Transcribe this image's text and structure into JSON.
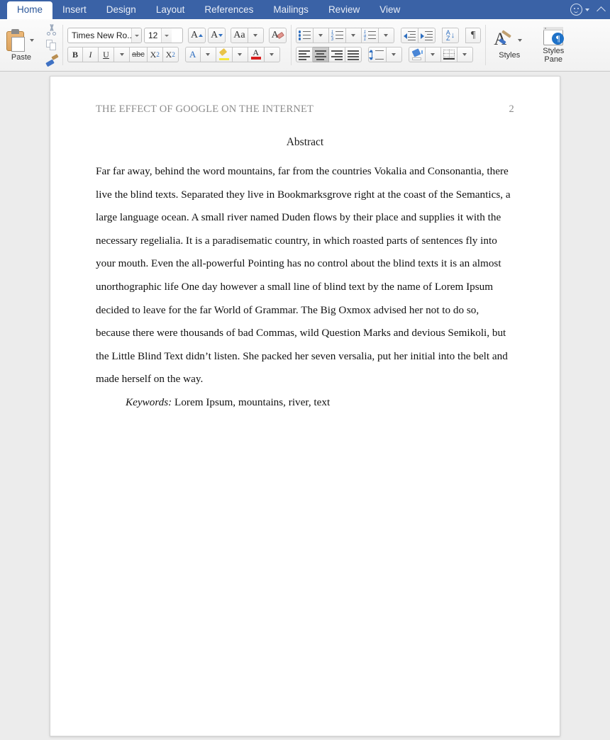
{
  "ribbon": {
    "tabs": [
      {
        "label": "Home",
        "active": true
      },
      {
        "label": "Insert",
        "active": false
      },
      {
        "label": "Design",
        "active": false
      },
      {
        "label": "Layout",
        "active": false
      },
      {
        "label": "References",
        "active": false
      },
      {
        "label": "Mailings",
        "active": false
      },
      {
        "label": "Review",
        "active": false
      },
      {
        "label": "View",
        "active": false
      }
    ],
    "right_controls": {
      "smiley_icon": "smiley-face-icon",
      "smiley_dropdown": "chevron-down-icon",
      "collapse_ribbon": "chevron-up-icon"
    },
    "clipboard": {
      "paste_label": "Paste",
      "paste_icon": "clipboard-paste-icon",
      "paste_dropdown": "chevron-down-icon",
      "cut_icon": "scissors-icon",
      "copy_icon": "copy-icon",
      "format_painter_icon": "format-painter-icon"
    },
    "font": {
      "name_value": "Times New Ro...",
      "name_placeholder": "Font",
      "size_value": "12",
      "size_placeholder": "Size",
      "grow_font": "A",
      "shrink_font": "A",
      "change_case": "Aa",
      "clear_formatting": "A",
      "bold": "B",
      "italic": "I",
      "underline": "U",
      "strikethrough": "abc",
      "subscript": "X",
      "subscript_index": "2",
      "superscript": "X",
      "superscript_index": "2",
      "text_effects": "A",
      "highlight_icon": "highlighter-icon",
      "font_color": "A"
    },
    "paragraph": {
      "bullets_icon": "bullet-list-icon",
      "numbering_icon": "numbered-list-icon",
      "multilevel_icon": "multilevel-list-icon",
      "decrease_indent_icon": "decrease-indent-icon",
      "increase_indent_icon": "increase-indent-icon",
      "sort_top": "A",
      "sort_bottom": "Z",
      "show_marks": "¶",
      "align_left_icon": "align-left-icon",
      "align_center_icon": "align-center-icon",
      "align_right_icon": "align-right-icon",
      "justify_icon": "justify-icon",
      "line_spacing_icon": "line-spacing-icon",
      "shading_icon": "shading-bucket-icon",
      "borders_icon": "borders-icon",
      "active_alignment": "center"
    },
    "styles": {
      "styles_label": "Styles",
      "styles_icon": "styles-brush-icon",
      "styles_pane_label_line1": "Styles",
      "styles_pane_label_line2": "Pane",
      "styles_pane_icon": "styles-pane-icon",
      "styles_pane_badge": "¶"
    }
  },
  "document": {
    "running_head": "THE EFFECT OF GOOGLE ON THE INTERNET",
    "page_number": "2",
    "heading": "Abstract",
    "body": "Far far away, behind the word mountains, far from the countries Vokalia and Consonantia, there live the blind texts. Separated they live in Bookmarksgrove right at the coast of the Semantics, a large language ocean. A small river named Duden flows by their place and supplies it with the necessary regelialia. It is a paradisematic country, in which roasted parts of sentences fly into your mouth. Even the all-powerful Pointing has no control about the blind texts it is an almost unorthographic life One day however a small line of blind text by the name of Lorem Ipsum decided to leave for the far World of Grammar. The Big Oxmox advised her not to do so, because there were thousands of bad Commas, wild Question Marks and devious Semikoli, but the Little Blind Text didn’t listen. She packed her seven versalia, put her initial into the belt and made herself on the way.",
    "keywords_label": "Keywords:",
    "keywords_value": "Lorem Ipsum, mountains, river, text"
  },
  "colors": {
    "ribbon_blue": "#3a62a6",
    "tab_text_active": "#2b579a",
    "canvas_gray": "#ececec",
    "page_white": "#ffffff",
    "running_head_gray": "#8c8c8c",
    "accent_blue": "#2f6fc0",
    "highlight_yellow": "#f5e63c",
    "font_color_red": "#d81f1f"
  }
}
